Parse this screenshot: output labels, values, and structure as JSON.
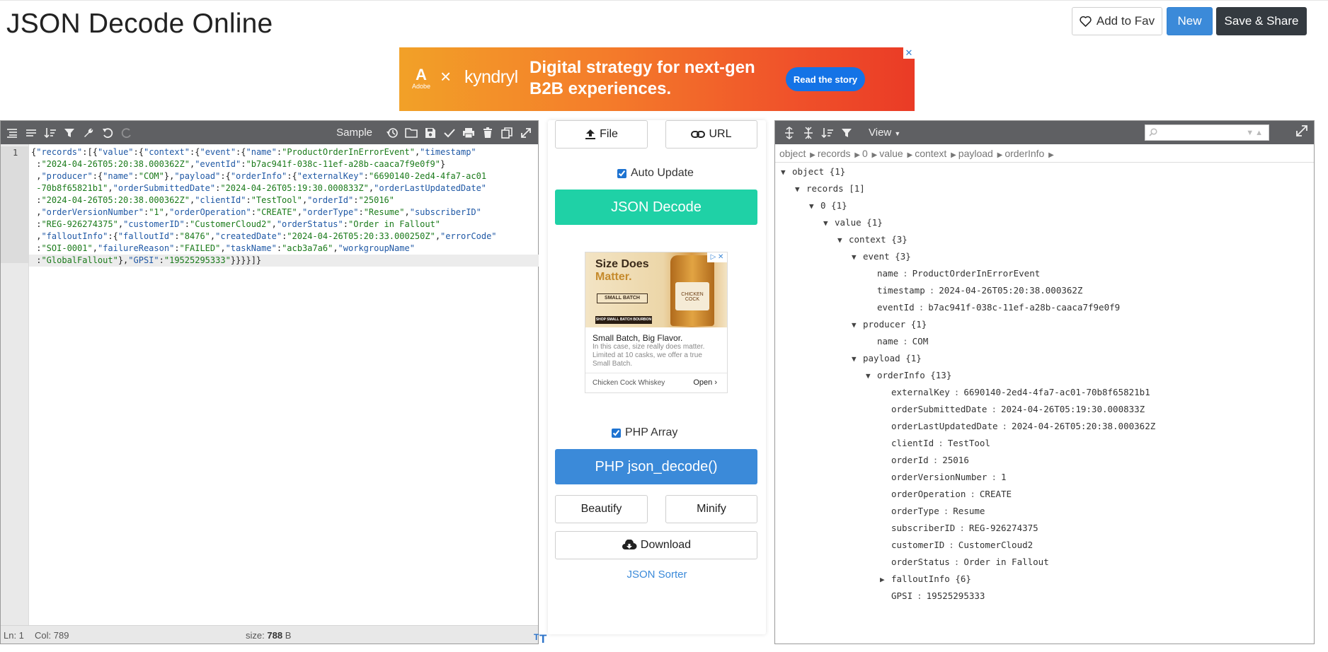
{
  "header": {
    "title": "JSON Decode Online",
    "fav_label": "Add to Fav",
    "new_label": "New",
    "save_label": "Save & Share"
  },
  "ad_banner": {
    "brand_small": "Adobe",
    "x": "×",
    "partner": "kyndryl",
    "headline_line1": "Digital strategy for next-gen",
    "headline_line2": "B2B experiences.",
    "cta": "Read the story",
    "close": "✕"
  },
  "editor": {
    "toolbar": {
      "sample_label": "Sample"
    },
    "line_number": "1",
    "status": {
      "ln": "Ln: 1",
      "col": "Col: 789",
      "size_label": "size:",
      "size_value": "788",
      "size_unit": "B"
    }
  },
  "middle": {
    "file_label": "File",
    "url_label": "URL",
    "auto_update_label": "Auto Update",
    "json_decode_label": "JSON Decode",
    "php_array_label": "PHP Array",
    "php_decode_label": "PHP json_decode()",
    "beautify_label": "Beautify",
    "minify_label": "Minify",
    "download_label": "Download",
    "sorter_label": "JSON Sorter",
    "ad": {
      "title1": "Size Does",
      "title2": "Matter.",
      "badge": "SMALL BATCH",
      "shop": "SHOP SMALL BATCH BOURBON",
      "label": "CHICKEN COCK",
      "body_title": "Small Batch, Big Flavor.",
      "body_text": "In this case, size really does matter. Limited at 10 casks, we offer a true Small Batch.",
      "brand": "Chicken Cock Whiskey",
      "open": "Open",
      "corner": "▷ ✕"
    }
  },
  "viewer": {
    "view_label": "View",
    "breadcrumb": [
      "object",
      "records",
      "0",
      "value",
      "context",
      "payload",
      "orderInfo"
    ],
    "tree": [
      {
        "level": 0,
        "tog": "▼",
        "key": "object",
        "count": "{1}"
      },
      {
        "level": 1,
        "tog": "▼",
        "key": "records",
        "count": "[1]"
      },
      {
        "level": 2,
        "tog": "▼",
        "key": "0",
        "count": "{1}"
      },
      {
        "level": 3,
        "tog": "▼",
        "key": "value",
        "count": "{1}"
      },
      {
        "level": 4,
        "tog": "▼",
        "key": "context",
        "count": "{3}"
      },
      {
        "level": 5,
        "tog": "▼",
        "key": "event",
        "count": "{3}"
      },
      {
        "level": 6,
        "key": "name",
        "val": "ProductOrderInErrorEvent"
      },
      {
        "level": 6,
        "key": "timestamp",
        "val": "2024-04-26T05:20:38.000362Z"
      },
      {
        "level": 6,
        "key": "eventId",
        "val": "b7ac941f-038c-11ef-a28b-caaca7f9e0f9"
      },
      {
        "level": 5,
        "tog": "▼",
        "key": "producer",
        "count": "{1}"
      },
      {
        "level": 6,
        "key": "name",
        "val": "COM"
      },
      {
        "level": 5,
        "tog": "▼",
        "key": "payload",
        "count": "{1}"
      },
      {
        "level": 6,
        "tog": "▼",
        "key": "orderInfo",
        "count": "{13}"
      },
      {
        "level": 7,
        "key": "externalKey",
        "val": "6690140-2ed4-4fa7-ac01-70b8f65821b1"
      },
      {
        "level": 7,
        "key": "orderSubmittedDate",
        "val": "2024-04-26T05:19:30.000833Z"
      },
      {
        "level": 7,
        "key": "orderLastUpdatedDate",
        "val": "2024-04-26T05:20:38.000362Z"
      },
      {
        "level": 7,
        "key": "clientId",
        "val": "TestTool"
      },
      {
        "level": 7,
        "key": "orderId",
        "val": "25016"
      },
      {
        "level": 7,
        "key": "orderVersionNumber",
        "val": "1"
      },
      {
        "level": 7,
        "key": "orderOperation",
        "val": "CREATE"
      },
      {
        "level": 7,
        "key": "orderType",
        "val": "Resume"
      },
      {
        "level": 7,
        "key": "subscriberID",
        "val": "REG-926274375"
      },
      {
        "level": 7,
        "key": "customerID",
        "val": "CustomerCloud2"
      },
      {
        "level": 7,
        "key": "orderStatus",
        "val": "Order in Fallout"
      },
      {
        "level": 7,
        "tog": "▶",
        "key": "falloutInfo",
        "count": "{6}"
      },
      {
        "level": 7,
        "key": "GPSI",
        "val": "19525295333"
      }
    ]
  },
  "code_lines": [
    [
      [
        "p",
        "{"
      ],
      [
        "k",
        "\"records\""
      ],
      [
        "p",
        ":[{"
      ],
      [
        "k",
        "\"value\""
      ],
      [
        "p",
        ":{"
      ],
      [
        "k",
        "\"context\""
      ],
      [
        "p",
        ":{"
      ],
      [
        "k",
        "\"event\""
      ],
      [
        "p",
        ":{"
      ],
      [
        "k",
        "\"name\""
      ],
      [
        "p",
        ":"
      ],
      [
        "s",
        "\"ProductOrderInErrorEvent\""
      ],
      [
        "p",
        ","
      ],
      [
        "k",
        "\"timestamp\""
      ]
    ],
    [
      [
        "p",
        " :"
      ],
      [
        "s",
        "\"2024-04-26T05:20:38.000362Z\""
      ],
      [
        "p",
        ","
      ],
      [
        "k",
        "\"eventId\""
      ],
      [
        "p",
        ":"
      ],
      [
        "s",
        "\"b7ac941f-038c-11ef-a28b-caaca7f9e0f9\""
      ],
      [
        "p",
        "}"
      ]
    ],
    [
      [
        "p",
        " ,"
      ],
      [
        "k",
        "\"producer\""
      ],
      [
        "p",
        ":{"
      ],
      [
        "k",
        "\"name\""
      ],
      [
        "p",
        ":"
      ],
      [
        "s",
        "\"COM\""
      ],
      [
        "p",
        "},"
      ],
      [
        "k",
        "\"payload\""
      ],
      [
        "p",
        ":{"
      ],
      [
        "k",
        "\"orderInfo\""
      ],
      [
        "p",
        ":{"
      ],
      [
        "k",
        "\"externalKey\""
      ],
      [
        "p",
        ":"
      ],
      [
        "s",
        "\"6690140-2ed4-4fa7-ac01"
      ]
    ],
    [
      [
        "s",
        " -70b8f65821b1\""
      ],
      [
        "p",
        ","
      ],
      [
        "k",
        "\"orderSubmittedDate\""
      ],
      [
        "p",
        ":"
      ],
      [
        "s",
        "\"2024-04-26T05:19:30.000833Z\""
      ],
      [
        "p",
        ","
      ],
      [
        "k",
        "\"orderLastUpdatedDate\""
      ]
    ],
    [
      [
        "p",
        " :"
      ],
      [
        "s",
        "\"2024-04-26T05:20:38.000362Z\""
      ],
      [
        "p",
        ","
      ],
      [
        "k",
        "\"clientId\""
      ],
      [
        "p",
        ":"
      ],
      [
        "s",
        "\"TestTool\""
      ],
      [
        "p",
        ","
      ],
      [
        "k",
        "\"orderId\""
      ],
      [
        "p",
        ":"
      ],
      [
        "s",
        "\"25016\""
      ]
    ],
    [
      [
        "p",
        " ,"
      ],
      [
        "k",
        "\"orderVersionNumber\""
      ],
      [
        "p",
        ":"
      ],
      [
        "s",
        "\"1\""
      ],
      [
        "p",
        ","
      ],
      [
        "k",
        "\"orderOperation\""
      ],
      [
        "p",
        ":"
      ],
      [
        "s",
        "\"CREATE\""
      ],
      [
        "p",
        ","
      ],
      [
        "k",
        "\"orderType\""
      ],
      [
        "p",
        ":"
      ],
      [
        "s",
        "\"Resume\""
      ],
      [
        "p",
        ","
      ],
      [
        "k",
        "\"subscriberID\""
      ]
    ],
    [
      [
        "p",
        " :"
      ],
      [
        "s",
        "\"REG-926274375\""
      ],
      [
        "p",
        ","
      ],
      [
        "k",
        "\"customerID\""
      ],
      [
        "p",
        ":"
      ],
      [
        "s",
        "\"CustomerCloud2\""
      ],
      [
        "p",
        ","
      ],
      [
        "k",
        "\"orderStatus\""
      ],
      [
        "p",
        ":"
      ],
      [
        "s",
        "\"Order in Fallout\""
      ]
    ],
    [
      [
        "p",
        " ,"
      ],
      [
        "k",
        "\"falloutInfo\""
      ],
      [
        "p",
        ":{"
      ],
      [
        "k",
        "\"falloutId\""
      ],
      [
        "p",
        ":"
      ],
      [
        "s",
        "\"8476\""
      ],
      [
        "p",
        ","
      ],
      [
        "k",
        "\"createdDate\""
      ],
      [
        "p",
        ":"
      ],
      [
        "s",
        "\"2024-04-26T05:20:33.000250Z\""
      ],
      [
        "p",
        ","
      ],
      [
        "k",
        "\"errorCode\""
      ]
    ],
    [
      [
        "p",
        " :"
      ],
      [
        "s",
        "\"SOI-0001\""
      ],
      [
        "p",
        ","
      ],
      [
        "k",
        "\"failureReason\""
      ],
      [
        "p",
        ":"
      ],
      [
        "s",
        "\"FAILED\""
      ],
      [
        "p",
        ","
      ],
      [
        "k",
        "\"taskName\""
      ],
      [
        "p",
        ":"
      ],
      [
        "s",
        "\"acb3a7a6\""
      ],
      [
        "p",
        ","
      ],
      [
        "k",
        "\"workgroupName\""
      ]
    ],
    [
      [
        "p",
        " :"
      ],
      [
        "s",
        "\"GlobalFallout\""
      ],
      [
        "p",
        "},"
      ],
      [
        "k",
        "\"GPSI\""
      ],
      [
        "p",
        ":"
      ],
      [
        "s",
        "\"19525295333\""
      ],
      [
        "p",
        "}}}}]}"
      ]
    ]
  ]
}
